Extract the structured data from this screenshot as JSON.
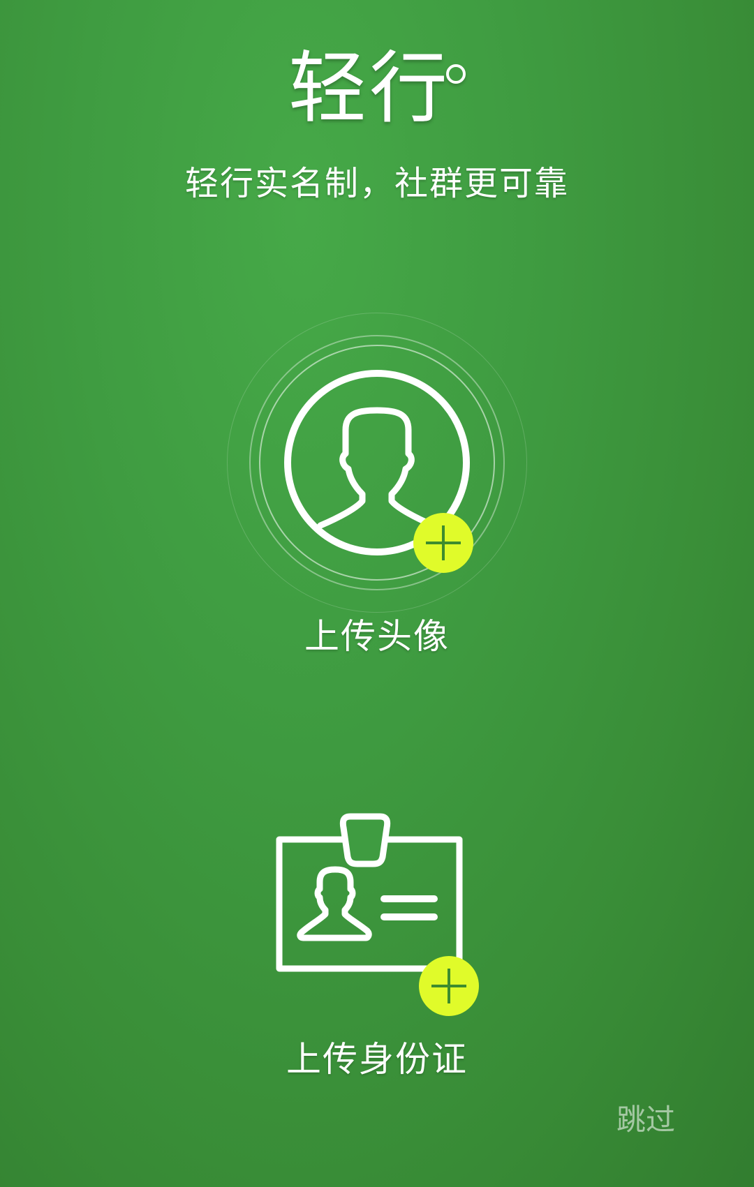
{
  "header": {
    "logo_text": "轻行",
    "tagline": "轻行实名制，社群更可靠"
  },
  "avatar_upload": {
    "label": "上传头像",
    "icon": "user-avatar-circle-icon",
    "badge_icon": "plus-icon",
    "badge_color": "#e0fb2a"
  },
  "id_upload": {
    "label": "上传身份证",
    "icon": "id-card-badge-icon",
    "badge_icon": "plus-icon",
    "badge_color": "#e0fb2a"
  },
  "footer": {
    "skip_label": "跳过"
  },
  "colors": {
    "background": "#3f9c41",
    "accent": "#e0fb2a",
    "text": "#ffffff"
  }
}
